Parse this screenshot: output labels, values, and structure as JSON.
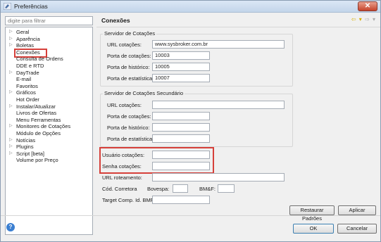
{
  "window": {
    "title": "Preferências",
    "close_glyph": "✕"
  },
  "filter": {
    "placeholder": "digite para filtrar"
  },
  "tree": {
    "items": [
      {
        "label": "Geral",
        "arrow": "▷"
      },
      {
        "label": "Aparência",
        "arrow": "▷"
      },
      {
        "label": "Boletas",
        "arrow": "▷"
      },
      {
        "label": "Conexões",
        "arrow": "",
        "selected": true
      },
      {
        "label": "Consulta de Ordens",
        "arrow": ""
      },
      {
        "label": "DDE e RTD",
        "arrow": ""
      },
      {
        "label": "DayTrade",
        "arrow": "▷"
      },
      {
        "label": "E-mail",
        "arrow": ""
      },
      {
        "label": "Favoritos",
        "arrow": ""
      },
      {
        "label": "Gráficos",
        "arrow": "▷"
      },
      {
        "label": "Hot Order",
        "arrow": ""
      },
      {
        "label": "Instalar/Atualizar",
        "arrow": "▷"
      },
      {
        "label": "Livros de Ofertas",
        "arrow": ""
      },
      {
        "label": "Menu Ferramentas",
        "arrow": ""
      },
      {
        "label": "Monitores de Cotações",
        "arrow": "▷"
      },
      {
        "label": "Módulo de Opções",
        "arrow": ""
      },
      {
        "label": "Notícias",
        "arrow": "▷"
      },
      {
        "label": "Plugins",
        "arrow": "▷"
      },
      {
        "label": "Script [beta]",
        "arrow": "▷"
      },
      {
        "label": "Volume por Preço",
        "arrow": ""
      }
    ]
  },
  "page": {
    "title": "Conexões",
    "nav_back": "⇦",
    "nav_menu": "▾",
    "nav_forward": "⇨"
  },
  "primary": {
    "title": "Servidor de Cotações",
    "url_label": "URL cotações:",
    "url_value": "www.sysbroker.com.br",
    "port_label": "Porta de cotações:",
    "port_value": "10003",
    "hist_label": "Porta de histórico:",
    "hist_value": "10005",
    "stats_label": "Porta de estatísticas:",
    "stats_value": "10007"
  },
  "secondary": {
    "title": "Servidor de Cotações Secundário",
    "url_label": "URL cotações:",
    "url_value": "",
    "port_label": "Porta de cotações:",
    "port_value": "",
    "hist_label": "Porta de histórico:",
    "hist_value": "",
    "stats_label": "Porta de estatísticas:",
    "stats_value": ""
  },
  "auth": {
    "user_label": "Usuário cotações:",
    "user_value": "",
    "pass_label": "Senha cotações:",
    "pass_value": ""
  },
  "routing": {
    "url_label": "URL roteamento:",
    "url_value": "",
    "broker_label": "Cód. Corretora",
    "bovespa_label": "Bovespa:",
    "bovespa_value": "",
    "bmf_label": "BM&F:",
    "bmf_value": "",
    "target_label": "Target Comp. Id. BMF:",
    "target_value": ""
  },
  "buttons": {
    "restore": "Restaurar Padrões",
    "apply": "Aplicar",
    "ok": "OK",
    "cancel": "Cancelar",
    "help": "?"
  },
  "colors": {
    "highlight": "#d6403a",
    "titlebar": "#c3d5ea",
    "nav_icon": "#d9b000"
  }
}
